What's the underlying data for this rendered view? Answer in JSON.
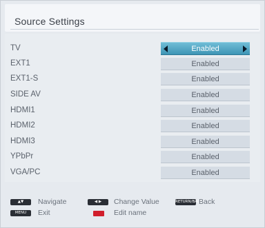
{
  "window": {
    "title": "Source Settings"
  },
  "sources": [
    {
      "label": "TV",
      "value": "Enabled",
      "selected": true
    },
    {
      "label": "EXT1",
      "value": "Enabled",
      "selected": false
    },
    {
      "label": "EXT1-S",
      "value": "Enabled",
      "selected": false
    },
    {
      "label": "SIDE AV",
      "value": "Enabled",
      "selected": false
    },
    {
      "label": "HDMI1",
      "value": "Enabled",
      "selected": false
    },
    {
      "label": "HDMI2",
      "value": "Enabled",
      "selected": false
    },
    {
      "label": "HDMI3",
      "value": "Enabled",
      "selected": false
    },
    {
      "label": "YPbPr",
      "value": "Enabled",
      "selected": false
    },
    {
      "label": "VGA/PC",
      "value": "Enabled",
      "selected": false
    }
  ],
  "footer": {
    "navigate": {
      "icon": "updown-key-icon",
      "label": "Navigate"
    },
    "change_value": {
      "icon": "leftright-key-icon",
      "label": "Change Value"
    },
    "back": {
      "icon": "return-back-key-icon",
      "key_text": "RETURN/BACK",
      "label": "Back"
    },
    "exit": {
      "icon": "menu-key-icon",
      "key_text": "MENU",
      "label": "Exit"
    },
    "edit_name": {
      "icon": "red-key-icon",
      "label": "Edit name"
    }
  },
  "colors": {
    "selected_value": "#3e95b5",
    "red_key": "#d11e2c"
  }
}
